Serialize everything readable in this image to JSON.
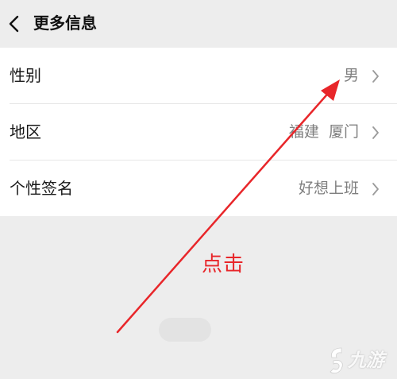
{
  "header": {
    "title": "更多信息",
    "back_icon": "chevron-left-icon"
  },
  "rows": [
    {
      "label": "性别",
      "value": "男"
    },
    {
      "label": "地区",
      "value": "福建  厦门"
    },
    {
      "label": "个性签名",
      "value": "好想上班"
    }
  ],
  "annotation": {
    "label": "点击",
    "color": "#e8262a"
  },
  "watermark": {
    "text": "九游"
  },
  "colors": {
    "background": "#ededed",
    "card": "#ffffff",
    "value_text": "#7f7f7f"
  }
}
